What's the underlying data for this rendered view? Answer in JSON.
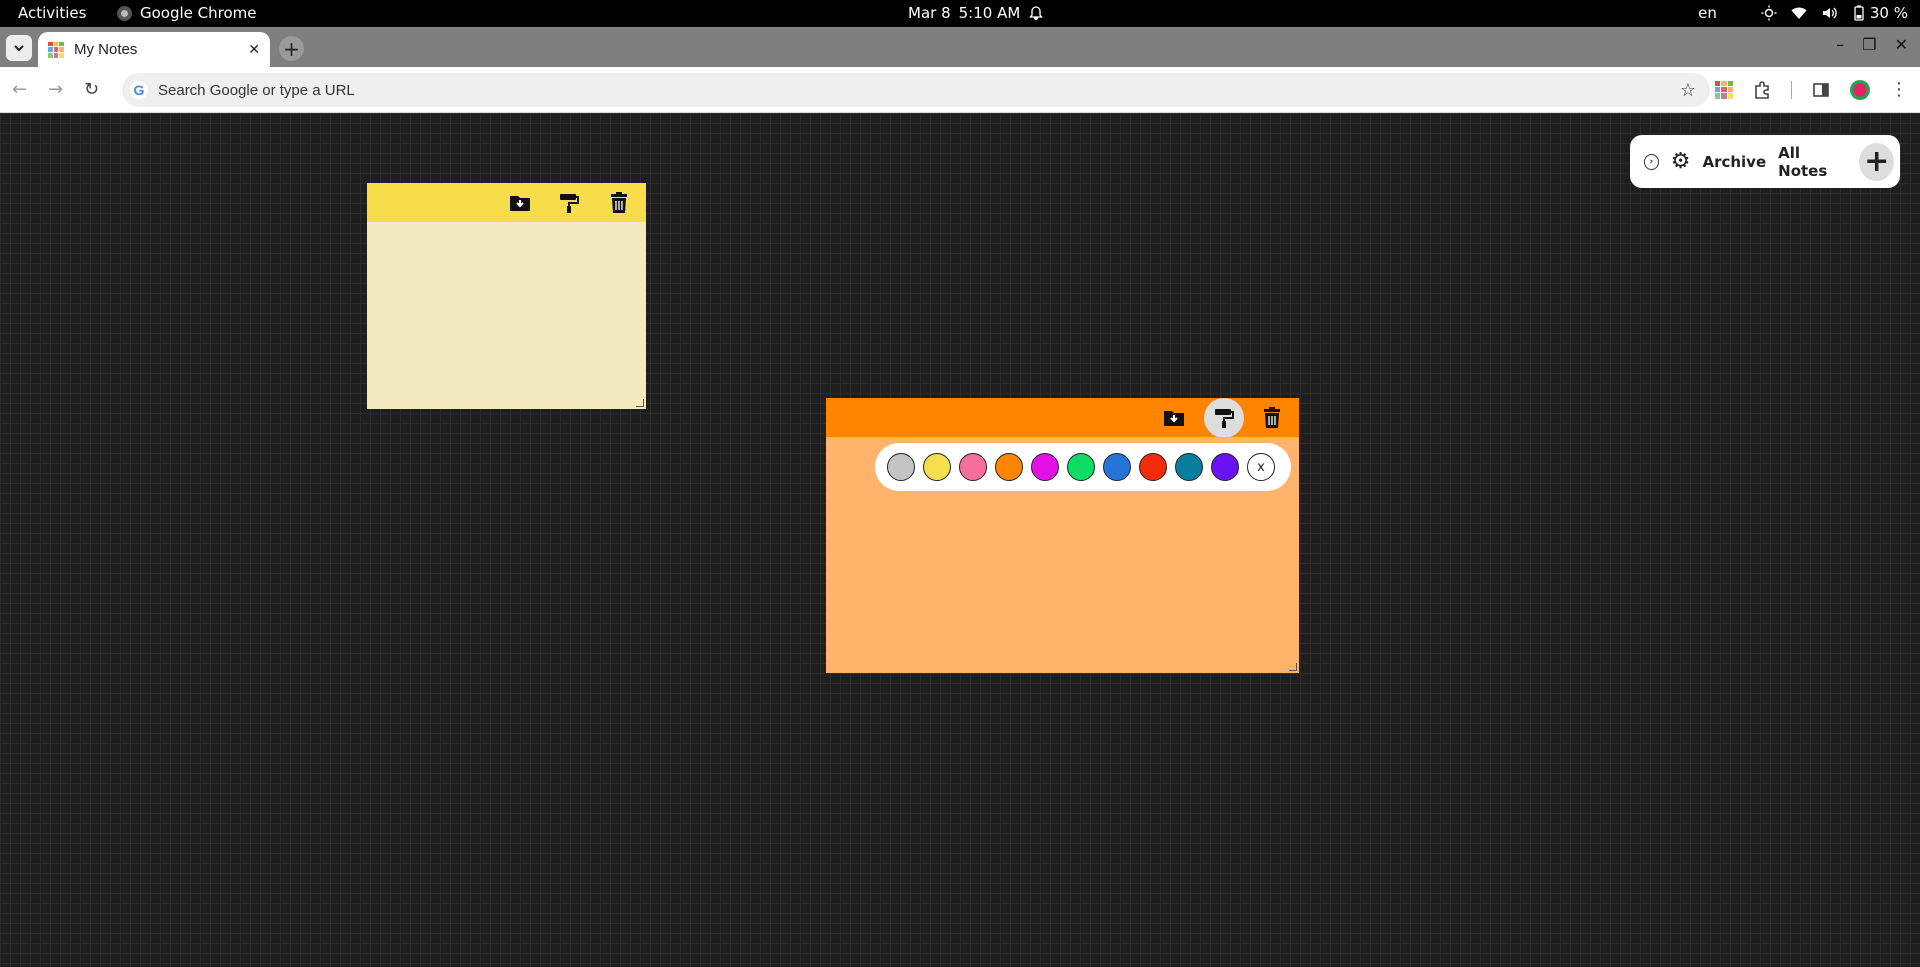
{
  "system_bar": {
    "activities": "Activities",
    "app_name": "Google Chrome",
    "date": "Mar 8",
    "time": "5:10 AM",
    "language": "en",
    "battery": "30 %"
  },
  "browser": {
    "tab_title": "My Notes",
    "omnibox_placeholder": "Search Google or type a URL"
  },
  "panel": {
    "archive_label": "Archive",
    "all_notes_label": "All Notes"
  },
  "notes": [
    {
      "header_color": "#f7dd4a",
      "body_color": "#f3ebbf"
    },
    {
      "header_color": "#ff8400",
      "body_color": "#ffb36b"
    }
  ],
  "palette": {
    "colors": [
      "#c4c4c4",
      "#f4df4e",
      "#f76f9c",
      "#ff8400",
      "#e411e4",
      "#0ddc66",
      "#2574d6",
      "#f32b08",
      "#087f9c",
      "#6a12f2"
    ],
    "close_label": "x"
  }
}
